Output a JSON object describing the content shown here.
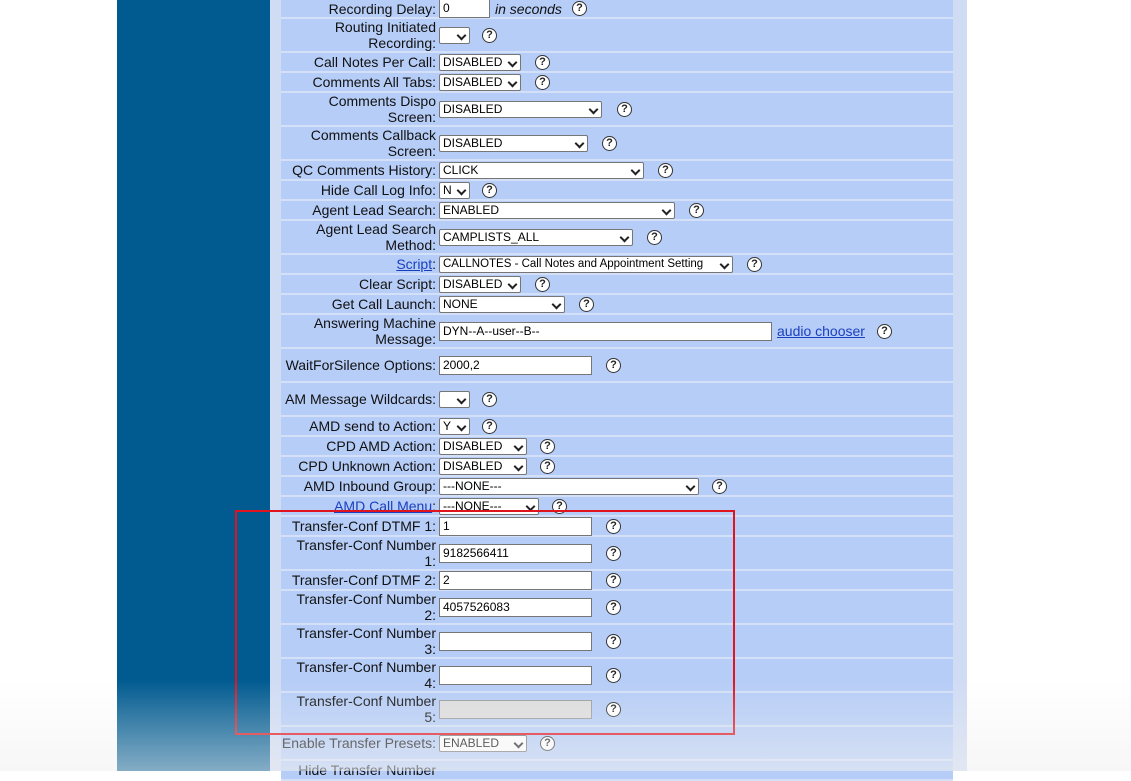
{
  "rows": {
    "recording_delay": {
      "label": "Recording Delay:",
      "value": "0",
      "hint": "in seconds"
    },
    "routing_initiated": {
      "label": "Routing Initiated Recording:",
      "value": ""
    },
    "call_notes": {
      "label": "Call Notes Per Call:",
      "value": "DISABLED"
    },
    "comments_all_tabs": {
      "label": "Comments All Tabs:",
      "value": "DISABLED"
    },
    "comments_dispo": {
      "label": "Comments Dispo Screen:",
      "value": "DISABLED"
    },
    "comments_callback": {
      "label": "Comments Callback Screen:",
      "value": "DISABLED"
    },
    "qc_comments": {
      "label": "QC Comments History:",
      "value": "CLICK"
    },
    "hide_call_log": {
      "label": "Hide Call Log Info:",
      "value": "N"
    },
    "agent_lead_search": {
      "label": "Agent Lead Search:",
      "value": "ENABLED"
    },
    "agent_lead_search_method": {
      "label": "Agent Lead Search Method:",
      "value": "CAMPLISTS_ALL"
    },
    "script": {
      "label": "Script",
      "label_suffix": ":",
      "value": "CALLNOTES - Call Notes and Appointment Setting"
    },
    "clear_script": {
      "label": "Clear Script:",
      "value": "DISABLED"
    },
    "get_call_launch": {
      "label": "Get Call Launch:",
      "value": "NONE"
    },
    "am_message": {
      "label": "Answering Machine Message:",
      "value": "DYN--A--user--B--",
      "link": "audio chooser"
    },
    "wait_for_silence": {
      "label": "WaitForSilence Options:",
      "value": "2000,2"
    },
    "am_wildcards": {
      "label": "AM Message Wildcards:",
      "value": ""
    },
    "amd_send": {
      "label": "AMD send to Action:",
      "value": "Y"
    },
    "cpd_amd": {
      "label": "CPD AMD Action:",
      "value": "DISABLED"
    },
    "cpd_unknown": {
      "label": "CPD Unknown Action:",
      "value": "DISABLED"
    },
    "amd_inbound": {
      "label": "AMD Inbound Group:",
      "value": "---NONE---"
    },
    "amd_call_menu": {
      "label": "AMD Call Menu",
      "label_suffix": ":",
      "value": "---NONE---"
    },
    "xfer_dtmf1": {
      "label": "Transfer-Conf DTMF 1:",
      "value": "1"
    },
    "xfer_num1": {
      "label": "Transfer-Conf Number 1:",
      "value": "9182566411"
    },
    "xfer_dtmf2": {
      "label": "Transfer-Conf DTMF 2:",
      "value": "2"
    },
    "xfer_num2": {
      "label": "Transfer-Conf Number 2:",
      "value": "4057526083"
    },
    "xfer_num3": {
      "label": "Transfer-Conf Number 3:",
      "value": ""
    },
    "xfer_num4": {
      "label": "Transfer-Conf Number 4:",
      "value": ""
    },
    "xfer_num5": {
      "label": "Transfer-Conf Number 5:",
      "value": ""
    },
    "enable_presets": {
      "label": "Enable Transfer Presets:",
      "value": "ENABLED"
    },
    "hide_xfer_number": {
      "label": "Hide Transfer Number",
      "value": ""
    }
  },
  "help_glyph": "?",
  "colors": {
    "sidebar": "#015b91",
    "row": "#b6cdf7",
    "highlight": "#e0141e"
  }
}
